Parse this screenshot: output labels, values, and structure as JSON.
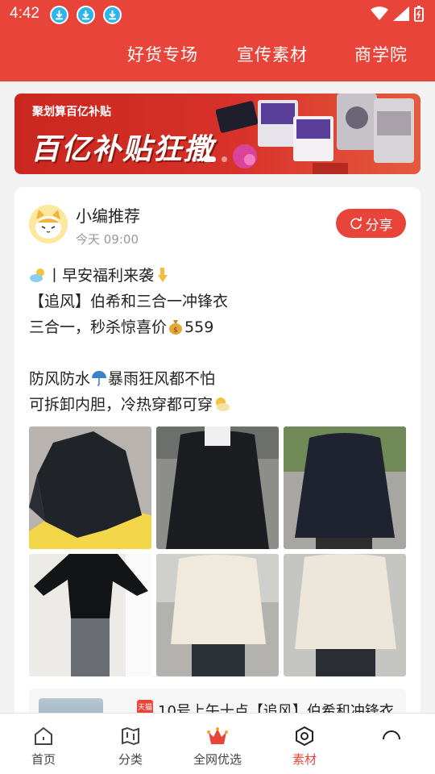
{
  "status_bar": {
    "time": "4:42"
  },
  "top_nav": {
    "items": [
      "好货专场",
      "宣传素材",
      "商学院"
    ]
  },
  "banner": {
    "subtitle": "聚划算百亿补贴",
    "title": "百亿补贴狂撒"
  },
  "post": {
    "author": "小编推荐",
    "time": "今天 09:00",
    "share_label": "分享",
    "lines": [
      "丨早安福利来袭",
      "【追风】伯希和三合一冲锋衣",
      "三合一，秒杀惊喜价",
      "559",
      "防风防水",
      "暴雨狂风都不怕",
      "可拆卸内胆，冷热穿都可穿"
    ]
  },
  "related": {
    "badge": "天猫",
    "text": "10号上午十点【追风】伯希和冲锋衣"
  },
  "bottom_nav": {
    "tabs": [
      "首页",
      "分类",
      "全网优选",
      "素材",
      ""
    ]
  },
  "colors": {
    "brand": "#e8443a"
  }
}
